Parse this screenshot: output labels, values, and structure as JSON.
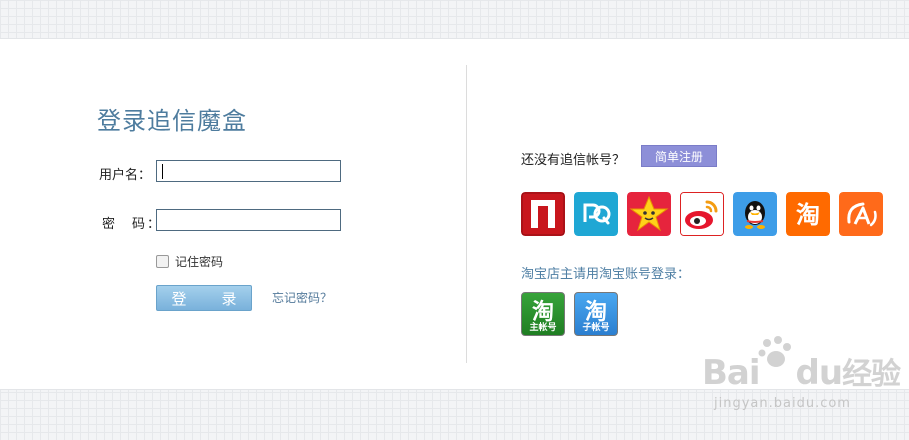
{
  "login": {
    "title": "登录追信魔盒",
    "username_label": "用户名：",
    "password_label": "密　码：",
    "remember_label": "记住密码",
    "login_button": "登　录",
    "forgot_link": "忘记密码？"
  },
  "register": {
    "prompt": "还没有追信帐号？",
    "button": "简单注册"
  },
  "third_party": {
    "icons": [
      "netease-icon",
      "tianya-icon",
      "xing-icon",
      "weibo-icon",
      "qq-icon",
      "taobao-icon",
      "alibaba-icon"
    ]
  },
  "taobao": {
    "hint": "淘宝店主请用淘宝账号登录：",
    "main_account": {
      "char": "淘",
      "label": "主帐号"
    },
    "sub_account": {
      "char": "淘",
      "label": "子帐号"
    }
  },
  "watermark": {
    "brand": "Bai",
    "brand2": "du",
    "brand_cn": "经验",
    "url": "jingyan.baidu.com"
  },
  "colors": {
    "title": "#4e7c9e",
    "login_button": "#79b1db",
    "register_button": "#8d8fd8",
    "link": "#53799a"
  }
}
